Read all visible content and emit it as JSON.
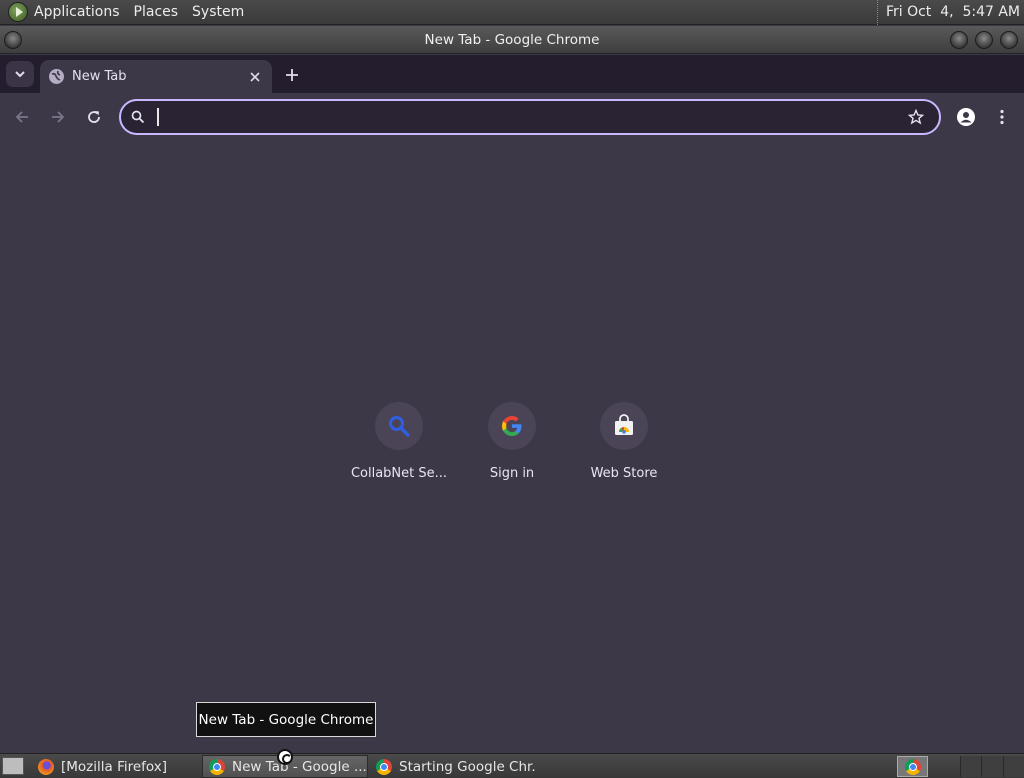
{
  "top_panel": {
    "menus": [
      "Applications",
      "Places",
      "System"
    ],
    "clock": "Fri Oct  4,  5:47 AM"
  },
  "window": {
    "title": "New Tab - Google Chrome"
  },
  "tabs": [
    {
      "label": "New Tab",
      "favicon": "globe-icon",
      "active": true
    }
  ],
  "omnibox": {
    "value": "",
    "placeholder": ""
  },
  "shortcuts": [
    {
      "label": "CollabNet Se...",
      "icon": "search-icon"
    },
    {
      "label": "Sign in",
      "icon": "google-g-icon"
    },
    {
      "label": "Web Store",
      "icon": "web-store-icon"
    }
  ],
  "tooltip": "New Tab - Google Chrome",
  "taskbar": {
    "tasks": [
      {
        "label": "[Mozilla Firefox]",
        "icon": "firefox-icon",
        "active": false
      },
      {
        "label": "New Tab - Google ...",
        "icon": "chrome-icon",
        "active": true
      },
      {
        "label": "Starting Google Chr...",
        "icon": "chrome-icon",
        "active": false
      }
    ]
  },
  "colors": {
    "frame": "#231d2d",
    "toolbar": "#3d3848",
    "omnibox_border": "#c9b7ff",
    "omnibox_bg": "#292333"
  }
}
